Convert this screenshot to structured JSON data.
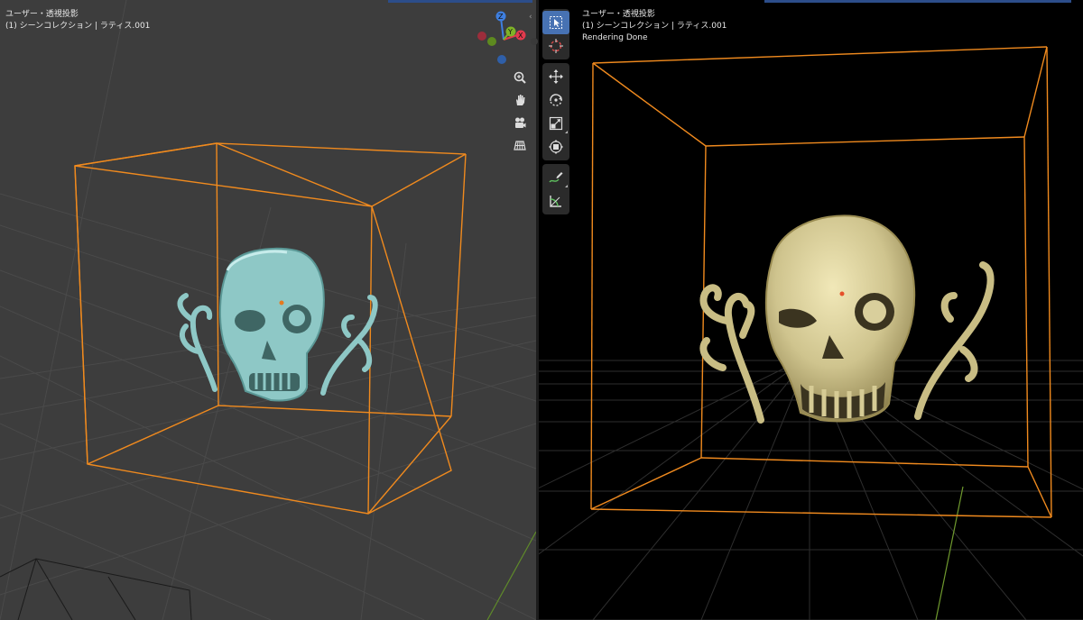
{
  "left_viewport": {
    "view_name": "ユーザー・透視投影",
    "collection": "(1) シーンコレクション | ラティス.001",
    "gizmo": {
      "x_label": "X",
      "y_label": "Y",
      "z_label": "Z"
    },
    "nav_icons": [
      "zoom-icon",
      "pan-hand-icon",
      "camera-icon",
      "grid-icon"
    ]
  },
  "right_viewport": {
    "view_name": "ユーザー・透視投影",
    "collection": "(1) シーンコレクション | ラティス.001",
    "status": "Rendering Done",
    "tools": [
      "select-box-icon",
      "cursor-icon",
      "move-icon",
      "rotate-icon",
      "scale-icon",
      "transform-icon",
      "annotate-icon",
      "measure-icon"
    ]
  },
  "colors": {
    "lattice": "#f08a1e",
    "skull_solid": "#8ec8c6",
    "skull_render": "#cfc48e",
    "gizmo_x": "#e23a4d",
    "gizmo_y": "#7fb327",
    "gizmo_z": "#3e7fe0",
    "active_tool": "#4772b3"
  }
}
